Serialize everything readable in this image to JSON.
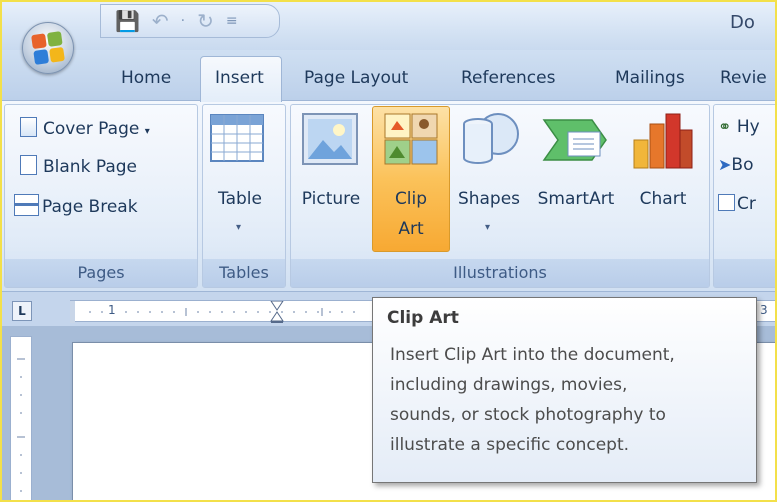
{
  "window": {
    "title_fragment": "Do"
  },
  "quick_access": {
    "icons": [
      "save-icon",
      "undo-icon",
      "redo-icon",
      "customize-icon"
    ]
  },
  "tabs": [
    "Home",
    "Insert",
    "Page Layout",
    "References",
    "Mailings",
    "Review"
  ],
  "tab_display": {
    "review": "Revie"
  },
  "active_tab": "Insert",
  "groups": {
    "pages": {
      "label": "Pages",
      "items": [
        "Cover Page",
        "Blank Page",
        "Page Break"
      ]
    },
    "tables": {
      "label": "Tables",
      "button": "Table"
    },
    "illustrations": {
      "label": "Illustrations",
      "buttons": [
        "Picture",
        "Clip",
        "Art",
        "Shapes",
        "SmartArt",
        "Chart"
      ]
    },
    "links": {
      "items": [
        "Hy",
        "Bo",
        "Cr"
      ]
    }
  },
  "ruler": {
    "numbers": [
      "1",
      "3"
    ]
  },
  "tooltip": {
    "title": "Clip Art",
    "lines": [
      "Insert Clip Art into the document,",
      "including drawings, movies,",
      "sounds, or stock photography to",
      "illustrate a specific concept."
    ]
  },
  "colors": {
    "highlight": "#f7a933",
    "ribbon_text": "#1e395b",
    "frame": "#f3e04a"
  }
}
